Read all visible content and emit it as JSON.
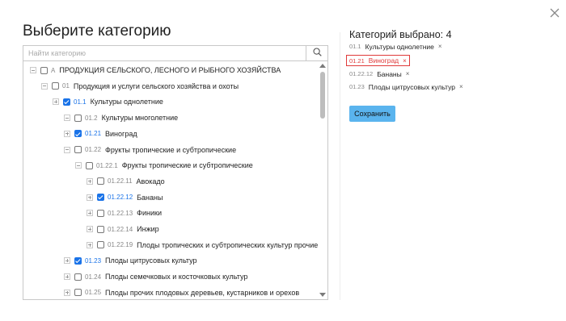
{
  "dialog": {
    "title": "Выберите категорию",
    "search": {
      "placeholder": "Найти категорию",
      "value": ""
    },
    "close_icon": "close-icon",
    "search_icon": "search-icon"
  },
  "tree": {
    "rows": [
      {
        "expander": "minus",
        "checked": false,
        "code": "А",
        "label": "ПРОДУКЦИЯ СЕЛЬСКОГО, ЛЕСНОГО И РЫБНОГО ХОЗЯЙСТВА"
      },
      {
        "expander": "minus",
        "checked": false,
        "code": "01",
        "label": "Продукция и услуги сельского хозяйства и охоты"
      },
      {
        "expander": "plus",
        "checked": true,
        "code": "01.1",
        "label": "Культуры однолетние"
      },
      {
        "expander": "minus",
        "checked": false,
        "code": "01.2",
        "label": "Культуры многолетние"
      },
      {
        "expander": "plus",
        "checked": true,
        "code": "01.21",
        "label": "Виноград"
      },
      {
        "expander": "minus",
        "checked": false,
        "code": "01.22",
        "label": "Фрукты тропические и субтропические"
      },
      {
        "expander": "minus",
        "checked": false,
        "code": "01.22.1",
        "label": "Фрукты тропические и субтропические"
      },
      {
        "expander": "plus",
        "checked": false,
        "code": "01.22.11",
        "label": "Авокадо"
      },
      {
        "expander": "plus",
        "checked": true,
        "code": "01.22.12",
        "label": "Бананы"
      },
      {
        "expander": "plus",
        "checked": false,
        "code": "01.22.13",
        "label": "Финики"
      },
      {
        "expander": "plus",
        "checked": false,
        "code": "01.22.14",
        "label": "Инжир"
      },
      {
        "expander": "plus",
        "checked": false,
        "code": "01.22.19",
        "label": "Плоды тропических и субтропических культур прочие"
      },
      {
        "expander": "plus",
        "checked": true,
        "code": "01.23",
        "label": "Плоды цитрусовых культур"
      },
      {
        "expander": "plus",
        "checked": false,
        "code": "01.24",
        "label": "Плоды семечковых и косточковых культур"
      },
      {
        "expander": "plus",
        "checked": false,
        "code": "01.25",
        "label": "Плоды прочих плодовых деревьев, кустарников и орехов"
      }
    ]
  },
  "selected": {
    "title": "Категорий выбрано: 4",
    "remove_symbol": "×",
    "items": [
      {
        "code": "01.1",
        "label": "Культуры однолетние",
        "highlighted": false
      },
      {
        "code": "01.21",
        "label": "Виноград",
        "highlighted": true
      },
      {
        "code": "01.22.12",
        "label": "Бананы",
        "highlighted": false
      },
      {
        "code": "01.23",
        "label": "Плоды цитрусовых культур",
        "highlighted": false
      }
    ],
    "save_label": "Сохранить"
  },
  "colors": {
    "accent": "#1a73e8",
    "save_button": "#5ab4ee",
    "highlight": "#e03a3a"
  }
}
